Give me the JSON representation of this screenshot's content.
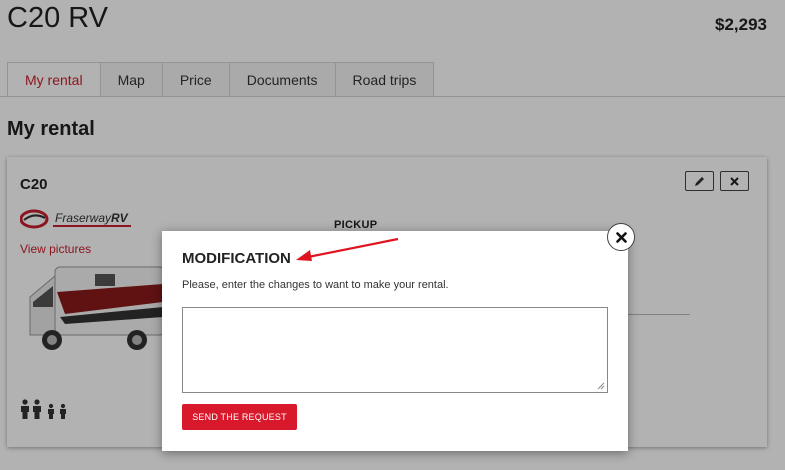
{
  "header": {
    "title": "C20 RV",
    "price": "$2,293"
  },
  "tabs": [
    {
      "label": "My rental",
      "active": true
    },
    {
      "label": "Map",
      "active": false
    },
    {
      "label": "Price",
      "active": false
    },
    {
      "label": "Documents",
      "active": false
    },
    {
      "label": "Road trips",
      "active": false
    }
  ],
  "section": {
    "title": "My rental"
  },
  "card": {
    "title": "C20",
    "logo": {
      "text_main": "Fraserway",
      "text_accent": "RV"
    },
    "view_pictures": "View pictures",
    "pickup_label": "PICKUP",
    "edit_icon": "pencil-icon",
    "remove_icon": "close-icon",
    "occupancy_icon": "people-icon"
  },
  "modal": {
    "title": "MODIFICATION",
    "instruction": "Please, enter the changes to want to make your rental.",
    "textarea_value": "",
    "send_label": "SEND THE REQUEST",
    "close_icon": "close-icon"
  },
  "colors": {
    "accent": "#c8202f",
    "button": "#d7192b",
    "annotation_arrow": "#e0141e"
  }
}
